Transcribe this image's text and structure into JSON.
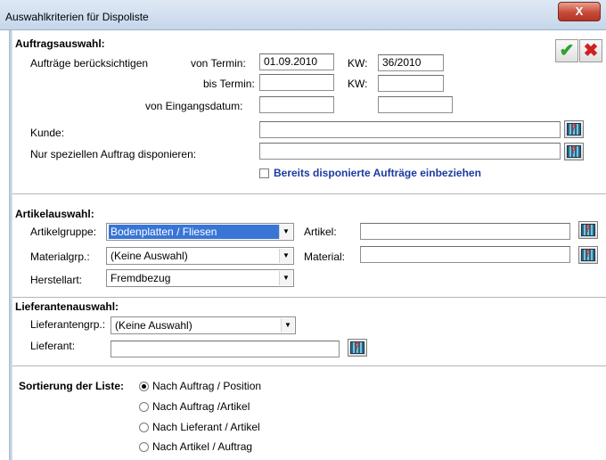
{
  "window": {
    "title": "Auswahlkriterien für Dispoliste",
    "close_label": "X"
  },
  "actions": {
    "ok_icon": "checkmark-icon",
    "ok_symbol": "✔",
    "cancel_icon": "cross-icon",
    "cancel_symbol": "✖"
  },
  "auftrag": {
    "title": "Auftragsauswahl:",
    "beruecksichtigen_label": "Aufträge berücksichtigen",
    "von_termin_label": "von Termin:",
    "von_termin_value": "01.09.2010",
    "kw_label": "KW:",
    "kw_value": "36/2010",
    "bis_termin_label": "bis Termin:",
    "bis_termin_value": "",
    "kw2_label": "KW:",
    "kw2_value": "",
    "eingang_label": "von Eingangsdatum:",
    "eingang_value": "",
    "eingang2_value": "",
    "kunde_label": "Kunde:",
    "kunde_value": "",
    "auftrag_label": "Nur speziellen Auftrag disponieren:",
    "auftrag_value": "",
    "bereits_label": "Bereits disponierte Aufträge einbeziehen"
  },
  "artikel": {
    "title": "Artikelauswahl:",
    "gruppe_label": "Artikelgruppe:",
    "gruppe_value": "Bodenplatten / Fliesen",
    "artikel_label": "Artikel:",
    "artikel_value": "",
    "materialgrp_label": "Materialgrp.:",
    "materialgrp_value": "(Keine Auswahl)",
    "material_label": "Material:",
    "material_value": "",
    "herstellart_label": "Herstellart:",
    "herstellart_value": "Fremdbezug"
  },
  "lieferant": {
    "title": "Lieferantenauswahl:",
    "grp_label": "Lieferantengrp.:",
    "grp_value": "(Keine Auswahl)",
    "lieferant_label": "Lieferant:",
    "lieferant_value": ""
  },
  "sortierung": {
    "label": "Sortierung der Liste:",
    "options": [
      "Nach Auftrag / Position",
      "Nach Auftrag /Artikel",
      "Nach Lieferant / Artikel",
      "Nach Artikel / Auftrag"
    ],
    "selected_index": 0
  },
  "lookup_symbol": "?",
  "dropdown_arrow": "▼"
}
